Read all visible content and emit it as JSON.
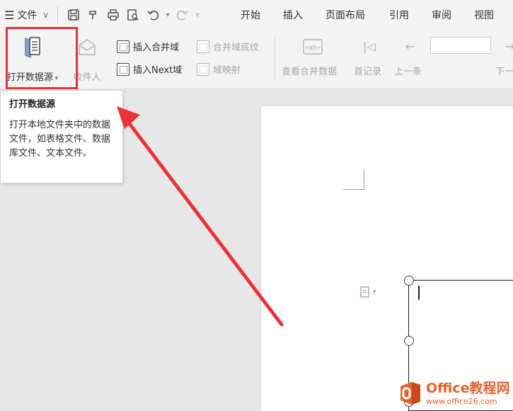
{
  "menu": {
    "file_label": "文件",
    "tabs": [
      "开始",
      "插入",
      "页面布局",
      "引用",
      "审阅",
      "视图"
    ]
  },
  "ribbon": {
    "open_source_label": "打开数据源",
    "recipient_label": "收件人",
    "insert_merge_field": "插入合并域",
    "insert_next_field": "插入Next域",
    "merge_field_shading": "合并域底纹",
    "field_mapping": "域映射",
    "view_merged_data": "查看合并数据",
    "first_record": "首记录",
    "prev_record": "上一条",
    "next_record": "下一"
  },
  "tooltip": {
    "title": "打开数据源",
    "body": "打开本地文件夹中的数据文件，如表格文件、数据库文件、文本文件。"
  },
  "watermark": {
    "name": "Office教程网",
    "url": "www.office26.com"
  },
  "colors": {
    "highlight": "#e8333b",
    "logo": "#e8612c"
  }
}
